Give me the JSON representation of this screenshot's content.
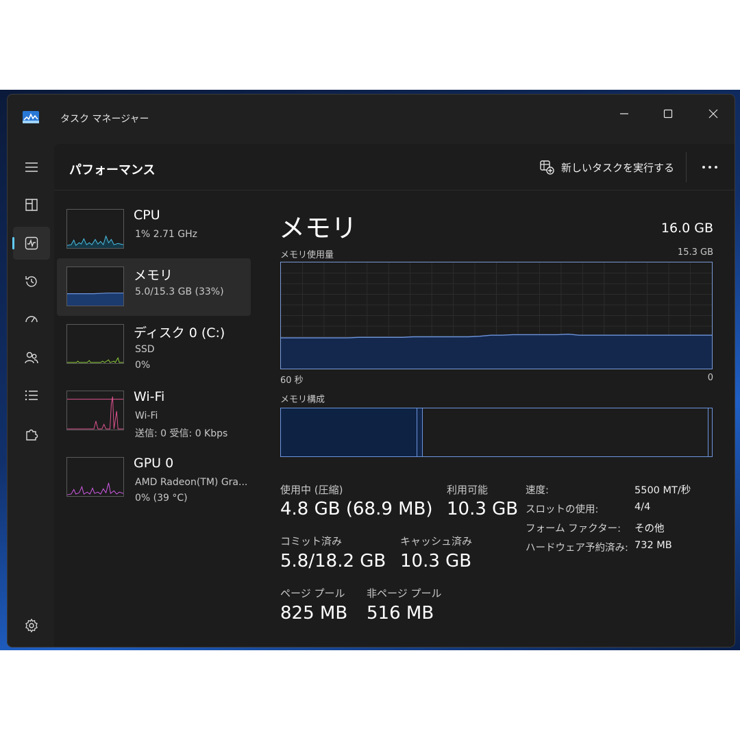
{
  "window": {
    "title": "タスク マネージャー"
  },
  "nav": {
    "items": [
      {
        "name": "hamburger"
      },
      {
        "name": "processes"
      },
      {
        "name": "performance",
        "active": true
      },
      {
        "name": "app-history"
      },
      {
        "name": "startup-apps"
      },
      {
        "name": "users"
      },
      {
        "name": "details"
      },
      {
        "name": "services"
      },
      {
        "name": "settings"
      }
    ]
  },
  "header": {
    "title": "パフォーマンス",
    "run_task_label": "新しいタスクを実行する"
  },
  "devices": [
    {
      "title": "CPU",
      "lines": [
        "1%  2.71 GHz"
      ],
      "color": "#4cc2e6"
    },
    {
      "title": "メモリ",
      "lines": [
        "5.0/15.3 GB (33%)"
      ],
      "color": "#6d95de",
      "selected": true
    },
    {
      "title": "ディスク 0 (C:)",
      "lines": [
        "SSD",
        "0%"
      ],
      "color": "#8fce3a"
    },
    {
      "title": "Wi-Fi",
      "lines": [
        "Wi-Fi",
        "送信: 0  受信: 0 Kbps"
      ],
      "color": "#e0538f"
    },
    {
      "title": "GPU 0",
      "lines": [
        "AMD Radeon(TM) Gra...",
        "0%  (39 °C)"
      ],
      "color": "#d35be8"
    }
  ],
  "memory": {
    "title": "メモリ",
    "total": "16.0 GB",
    "usage_label": "メモリ使用量",
    "usage_max": "15.3 GB",
    "time_left": "60 秒",
    "time_right": "0",
    "composition_label": "メモリ構成",
    "usage_history_pct": [
      29,
      29,
      29,
      29,
      29,
      29,
      29,
      29.5,
      29.5,
      29.5,
      29.5,
      29.5,
      30,
      30,
      30,
      30,
      30,
      30,
      30.5,
      31.5,
      31.5,
      32,
      32,
      32,
      32,
      32,
      32.5,
      31.5,
      31.5,
      31.5,
      31.5,
      31.5,
      31.5,
      31.5,
      31.5,
      31.5,
      31.5,
      31.5,
      31.5,
      31.5
    ],
    "stats": {
      "in_use_label": "使用中 (圧縮)",
      "in_use_value": "4.8 GB (68.9 MB)",
      "available_label": "利用可能",
      "available_value": "10.3 GB",
      "committed_label": "コミット済み",
      "committed_value": "5.8/18.2 GB",
      "cached_label": "キャッシュ済み",
      "cached_value": "10.3 GB",
      "paged_label": "ページ プール",
      "paged_value": "825 MB",
      "nonpaged_label": "非ページ プール",
      "nonpaged_value": "516 MB"
    },
    "specs": [
      {
        "key": "速度:",
        "value": "5500 MT/秒"
      },
      {
        "key": "スロットの使用:",
        "value": "4/4"
      },
      {
        "key": "フォーム ファクター:",
        "value": "その他"
      },
      {
        "key": "ハードウェア予約済み:",
        "value": "732 MB"
      }
    ]
  },
  "colors": {
    "accent": "#60cdff",
    "memory": "#6d95de",
    "window_bg": "#202020",
    "panel_bg": "#1c1c1c"
  }
}
